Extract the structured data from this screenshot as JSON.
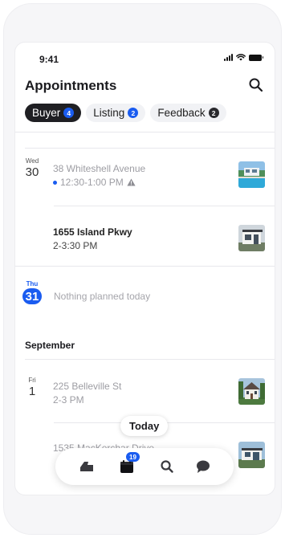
{
  "status_bar": {
    "time": "9:41",
    "icons": [
      "signal-icon",
      "wifi-icon",
      "battery-icon"
    ]
  },
  "header": {
    "title": "Appointments",
    "search_icon": "search-icon"
  },
  "tabs": [
    {
      "label": "Buyer",
      "count": "4",
      "active": true
    },
    {
      "label": "Listing",
      "count": "2",
      "active": false
    },
    {
      "label": "Feedback",
      "count": "2",
      "active": false
    }
  ],
  "days": [
    {
      "dow": "Wed",
      "date": "30",
      "appointments": [
        {
          "address": "38 Whiteshell Avenue",
          "time": "12:30-1:00 PM",
          "state": "past",
          "thumb": "house-pool-thumbnail"
        },
        {
          "address": "1655 Island Pkwy",
          "time": "2-3:30 PM",
          "state": "upcoming",
          "thumb": "modern-house-thumbnail"
        }
      ]
    },
    {
      "dow": "Thu",
      "date": "31",
      "today": true,
      "empty_text": "Nothing planned today"
    }
  ],
  "month_header": "September",
  "september": [
    {
      "dow": "Fri",
      "date": "1",
      "appointments": [
        {
          "address": "225 Belleville St",
          "time": "2-3 PM",
          "state": "past",
          "thumb": "victorian-house-thumbnail"
        },
        {
          "address": "1535 MacKerchar Drive",
          "time": "",
          "state": "past",
          "thumb": "modern-house-thumbnail-2"
        }
      ]
    }
  ],
  "today_button": "Today",
  "bottom_nav": {
    "items": [
      "home-icon",
      "calendar-icon",
      "search-icon",
      "chat-icon"
    ],
    "calendar_badge": "19"
  },
  "colors": {
    "accent": "#1a5cf0",
    "dark": "#1f1f23",
    "muted": "#9d9da3"
  }
}
